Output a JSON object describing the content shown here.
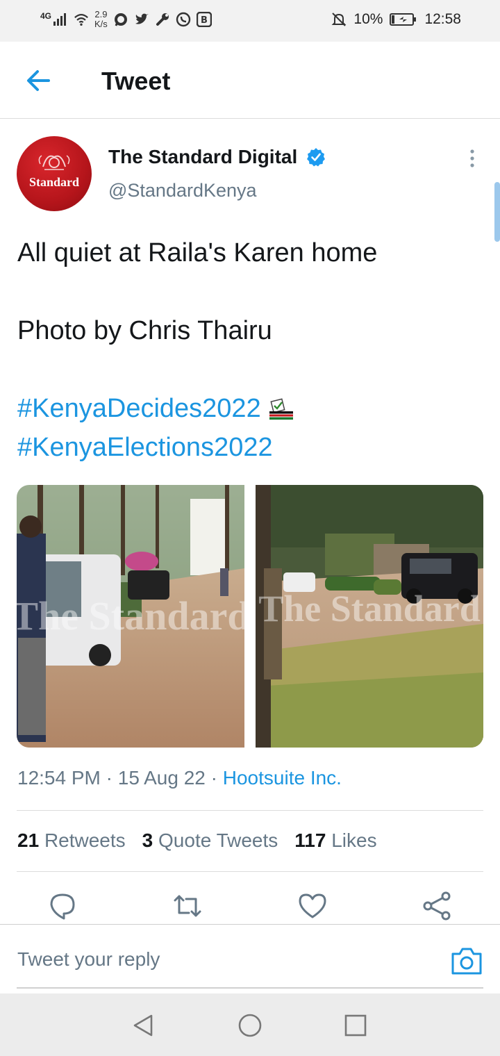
{
  "status_bar": {
    "network": "4G",
    "speed_value": "2.9",
    "speed_unit": "K/s",
    "battery": "10%",
    "time": "12:58"
  },
  "header": {
    "title": "Tweet"
  },
  "tweet": {
    "author_name": "The Standard Digital",
    "handle": "@StandardKenya",
    "avatar_text": "Standard",
    "verified": true,
    "text_line1": "All quiet at Raila's Karen home",
    "text_line2": "Photo by Chris Thairu",
    "hashtag1": "#KenyaDecides2022",
    "hashtag2": "#KenyaElections2022",
    "emoji": "ballot-box-icon",
    "time": "12:54 PM",
    "date": "15 Aug 22",
    "separator": "·",
    "via": "Hootsuite Inc.",
    "watermark": "The Standard"
  },
  "stats": {
    "retweets_count": "21",
    "retweets_label": "Retweets",
    "quotes_count": "3",
    "quotes_label": "Quote Tweets",
    "likes_count": "117",
    "likes_label": "Likes"
  },
  "actions": [
    "reply-icon",
    "retweet-icon",
    "like-icon",
    "share-icon"
  ],
  "reply_bar": {
    "placeholder": "Tweet your reply"
  },
  "colors": {
    "accent": "#1b95e0",
    "avatar_red": "#c8161d",
    "secondary_text": "#657786"
  }
}
